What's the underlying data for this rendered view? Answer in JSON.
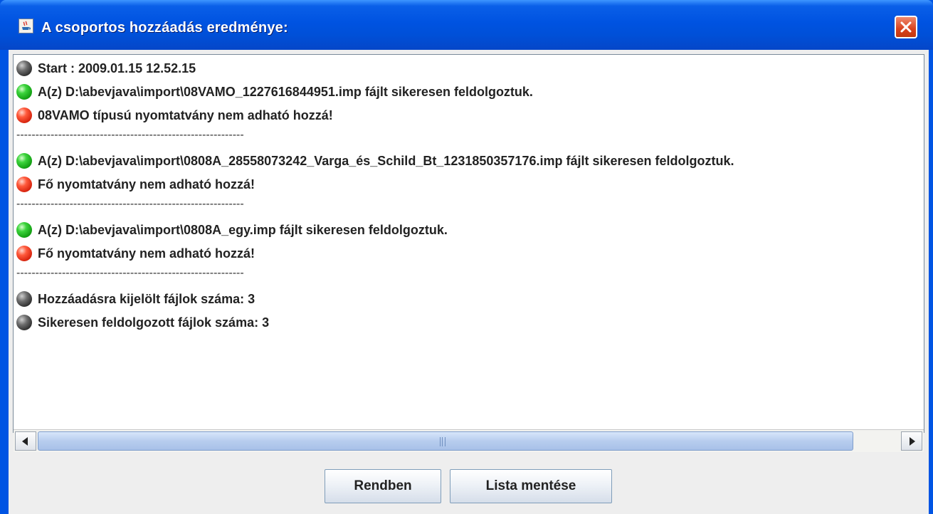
{
  "window": {
    "title": "A csoportos hozzáadás eredménye:"
  },
  "log": {
    "lines": [
      {
        "status": "info",
        "text": "Start : 2009.01.15 12.52.15"
      },
      {
        "status": "ok",
        "text": "A(z) D:\\abevjava\\import\\08VAMO_1227616844951.imp fájlt sikeresen feldolgoztuk."
      },
      {
        "status": "error",
        "text": "08VAMO típusú nyomtatvány nem adható hozzá!"
      },
      {
        "status": "separator",
        "text": "------------------------------------------------------------"
      },
      {
        "status": "ok",
        "text": "A(z) D:\\abevjava\\import\\0808A_28558073242_Varga_és_Schild_Bt_1231850357176.imp fájlt sikeresen feldolgoztuk."
      },
      {
        "status": "error",
        "text": "Fő nyomtatvány nem adható hozzá!"
      },
      {
        "status": "separator",
        "text": "------------------------------------------------------------"
      },
      {
        "status": "ok",
        "text": "A(z) D:\\abevjava\\import\\0808A_egy.imp fájlt sikeresen feldolgoztuk."
      },
      {
        "status": "error",
        "text": "Fő nyomtatvány nem adható hozzá!"
      },
      {
        "status": "separator",
        "text": "------------------------------------------------------------"
      },
      {
        "status": "info",
        "text": "Hozzáadásra kijelölt fájlok száma: 3"
      },
      {
        "status": "info",
        "text": "Sikeresen feldolgozott fájlok száma: 3"
      }
    ]
  },
  "buttons": {
    "ok_label": "Rendben",
    "save_label": "Lista mentése"
  },
  "colors": {
    "titlebar": "#0054e3",
    "status_ok": "#1fb81f",
    "status_error": "#e0311a",
    "status_info": "#4a4a4a"
  },
  "icons": {
    "status_ok": "green-ball-icon",
    "status_error": "red-ball-icon",
    "status_info": "gray-ball-icon",
    "app": "java-app-icon",
    "close": "close-icon"
  }
}
